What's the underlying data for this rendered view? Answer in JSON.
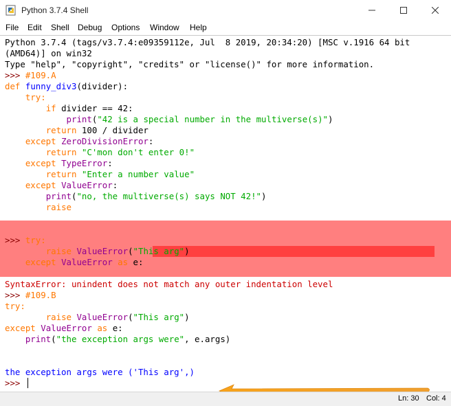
{
  "window": {
    "title": "Python 3.7.4 Shell",
    "controls": [
      "minimize",
      "maximize",
      "close"
    ]
  },
  "menu": [
    "File",
    "Edit",
    "Shell",
    "Debug",
    "Options",
    "Window",
    "Help"
  ],
  "shell": {
    "banner": [
      "Python 3.7.4 (tags/v3.7.4:e09359112e, Jul  8 2019, 20:34:20) [MSC v.1916 64 bit",
      "(AMD64)] on win32",
      "Type \"help\", \"copyright\", \"credits\" or \"license()\" for more information."
    ],
    "prompt": ">>> ",
    "block1": {
      "comment": "#109.A",
      "l_def_kw": "def",
      "l_def_name": "funny_div3",
      "l_def_rest": "(divider):",
      "l_try": "try:",
      "l_if_kw": "if",
      "l_if_rest": " divider == 42:",
      "l_print1_fn": "print",
      "l_print1_open": "(",
      "l_print1_str": "\"42 is a special number in the multiverse(s)\"",
      "l_print1_close": ")",
      "l_ret1_kw": "return",
      "l_ret1_rest": " 100 / divider",
      "l_exc1_kw": "except",
      "l_exc1_name": "ZeroDivisionError",
      "l_exc1_colon": ":",
      "l_ret2_kw": "return",
      "l_ret2_str": "\"C'mon don't enter 0!\"",
      "l_exc2_kw": "except",
      "l_exc2_name": "TypeError",
      "l_exc2_colon": ":",
      "l_ret3_kw": "return",
      "l_ret3_str": "\"Enter a number value\"",
      "l_exc3_kw": "except",
      "l_exc3_name": "ValueError",
      "l_exc3_colon": ":",
      "l_print2_fn": "print",
      "l_print2_open": "(",
      "l_print2_str": "\"no, the multiverse(s) says NOT 42!\"",
      "l_print2_close": ")",
      "l_raise": "raise"
    },
    "block_error": {
      "l_try": "try:",
      "l_raise_kw": "raise",
      "l_raise_name": "ValueError",
      "l_raise_open": "(",
      "l_raise_str": "\"This arg\"",
      "l_raise_close": ")",
      "l_exc_kw": "except",
      "l_exc_name": "ValueError",
      "l_exc_as": "as",
      "l_exc_var": " e:",
      "error_message": "SyntaxError: unindent does not match any outer indentation level"
    },
    "block2": {
      "comment": "#109.B",
      "l_try": "try:",
      "l_raise_kw": "raise",
      "l_raise_name": "ValueError",
      "l_raise_open": "(",
      "l_raise_str": "\"This arg\"",
      "l_raise_close": ")",
      "l_exc_kw": "except",
      "l_exc_name": "ValueError",
      "l_exc_as": "as",
      "l_exc_var": " e:",
      "l_print_fn": "print",
      "l_print_open": "(",
      "l_print_str": "\"the exception args were\"",
      "l_print_rest": ", e.args)"
    },
    "output": "the exception args were ('This arg',)"
  },
  "colors": {
    "keyword": "#ff7700",
    "definition": "#0000ff",
    "string": "#00aa00",
    "builtin": "#900090",
    "prompt": "#8b0000",
    "stdout": "#0000ff",
    "error_band": "#ff7f7f",
    "error_bar": "#ff4040",
    "arrow": "#f5a623"
  },
  "status": {
    "line": "Ln: 30",
    "col": "Col: 4"
  }
}
